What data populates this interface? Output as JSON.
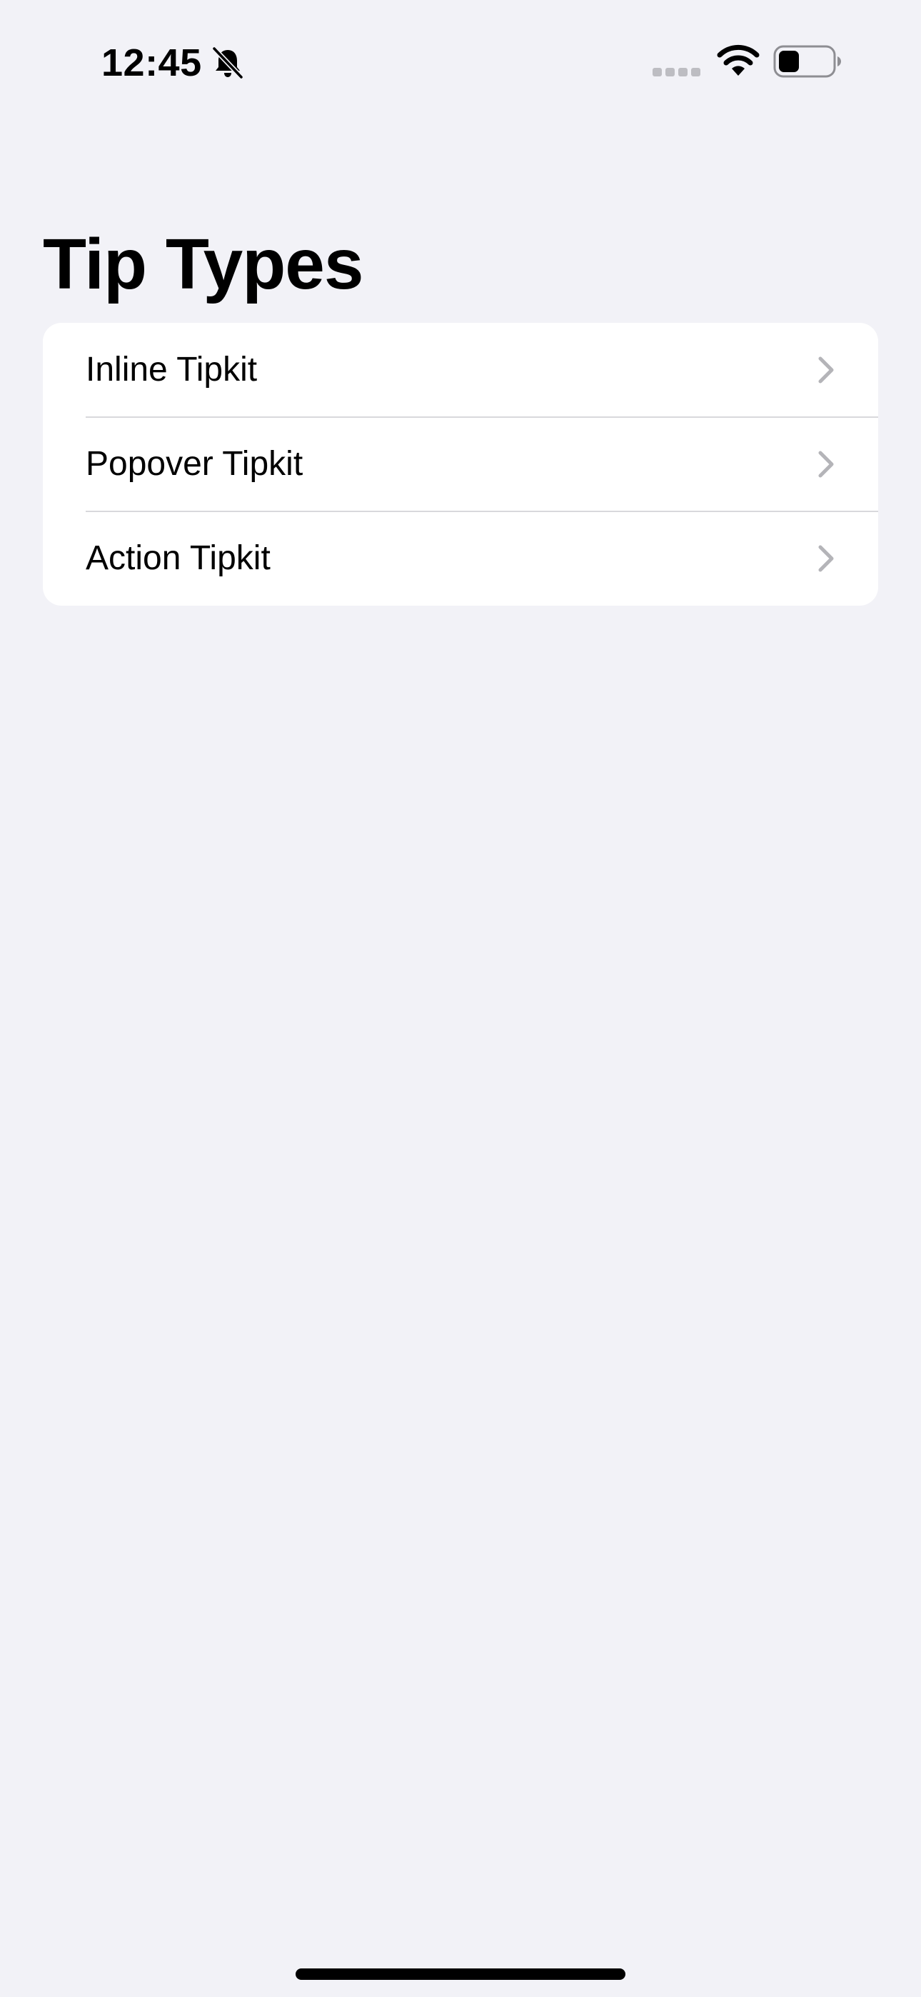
{
  "status_bar": {
    "time": "12:45",
    "icons": [
      "bell-slash-icon",
      "cellular-signal-icon",
      "wifi-icon",
      "battery-icon"
    ]
  },
  "title": "Tip Types",
  "list": {
    "items": [
      {
        "label": "Inline Tipkit",
        "icon": "chevron-right-icon"
      },
      {
        "label": "Popover Tipkit",
        "icon": "chevron-right-icon"
      },
      {
        "label": "Action Tipkit",
        "icon": "chevron-right-icon"
      }
    ]
  },
  "colors": {
    "background": "#f2f2f7",
    "card": "#ffffff",
    "divider": "#d8d8dc",
    "chevron": "#b4b4b8",
    "text": "#000000"
  }
}
